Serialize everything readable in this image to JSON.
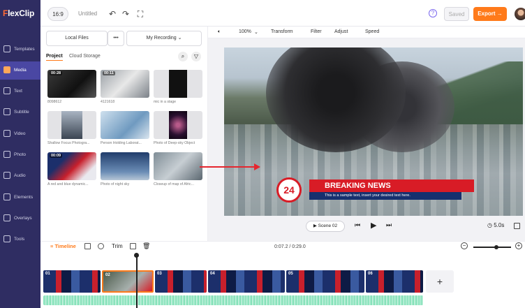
{
  "app": {
    "logo_prefix": "F",
    "logo_text": "lexClip"
  },
  "header": {
    "aspect_ratio": "16:9",
    "title": "Untitled",
    "saved_label": "Saved",
    "export_label": "Export →"
  },
  "sidebar": {
    "items": [
      {
        "label": "Templates",
        "icon": "templates-icon"
      },
      {
        "label": "Media",
        "icon": "media-icon",
        "active": true
      },
      {
        "label": "Text",
        "icon": "text-icon"
      },
      {
        "label": "Subtitle",
        "icon": "subtitle-icon"
      },
      {
        "label": "Video",
        "icon": "video-icon"
      },
      {
        "label": "Photo",
        "icon": "photo-icon"
      },
      {
        "label": "Audio",
        "icon": "audio-icon"
      },
      {
        "label": "Elements",
        "icon": "elements-icon"
      },
      {
        "label": "Overlays",
        "icon": "overlays-icon"
      },
      {
        "label": "Tools",
        "icon": "tools-icon"
      }
    ]
  },
  "media": {
    "local_files_label": "Local Files",
    "more_label": "•••",
    "my_recording_label": "My Recording",
    "subtabs": [
      "Project",
      "Cloud Storage"
    ],
    "thumbs": [
      {
        "caption": "8098612",
        "duration": "00:28"
      },
      {
        "caption": "4121618",
        "duration": "00:11"
      },
      {
        "caption": "mic in a stage",
        "duration": ""
      },
      {
        "caption": "Shallow Focus Photogra...",
        "duration": ""
      },
      {
        "caption": "Person Holding Laborat...",
        "duration": ""
      },
      {
        "caption": "Photo of Deep-sky Object",
        "duration": ""
      },
      {
        "caption": "A red and blue dynamic...",
        "duration": "00:09"
      },
      {
        "caption": "Photo of night sky",
        "duration": ""
      },
      {
        "caption": "Closeup of map of Afric...",
        "duration": ""
      }
    ]
  },
  "toolbar": {
    "zoom": "100%",
    "items": [
      "Transform",
      "Filter",
      "Adjust",
      "Speed"
    ]
  },
  "preview": {
    "badge_number": "24",
    "headline": "BREAKING NEWS",
    "subline": "This is a sample text, insert your desired text here."
  },
  "playbar": {
    "scene_label": "Scene 02",
    "duration_label": "5.0s"
  },
  "timeline": {
    "label": "Timeline",
    "trim_label": "Trim",
    "timecode": "0:07.2 / 0:29.0",
    "clips": [
      "01",
      "02",
      "03",
      "04",
      "05",
      "06"
    ],
    "add_label": "+"
  },
  "colors": {
    "accent": "#ff7a1a",
    "sidebar_bg": "#2f2d62",
    "breaking_red": "#d81c26",
    "breaking_blue": "#16306e"
  }
}
